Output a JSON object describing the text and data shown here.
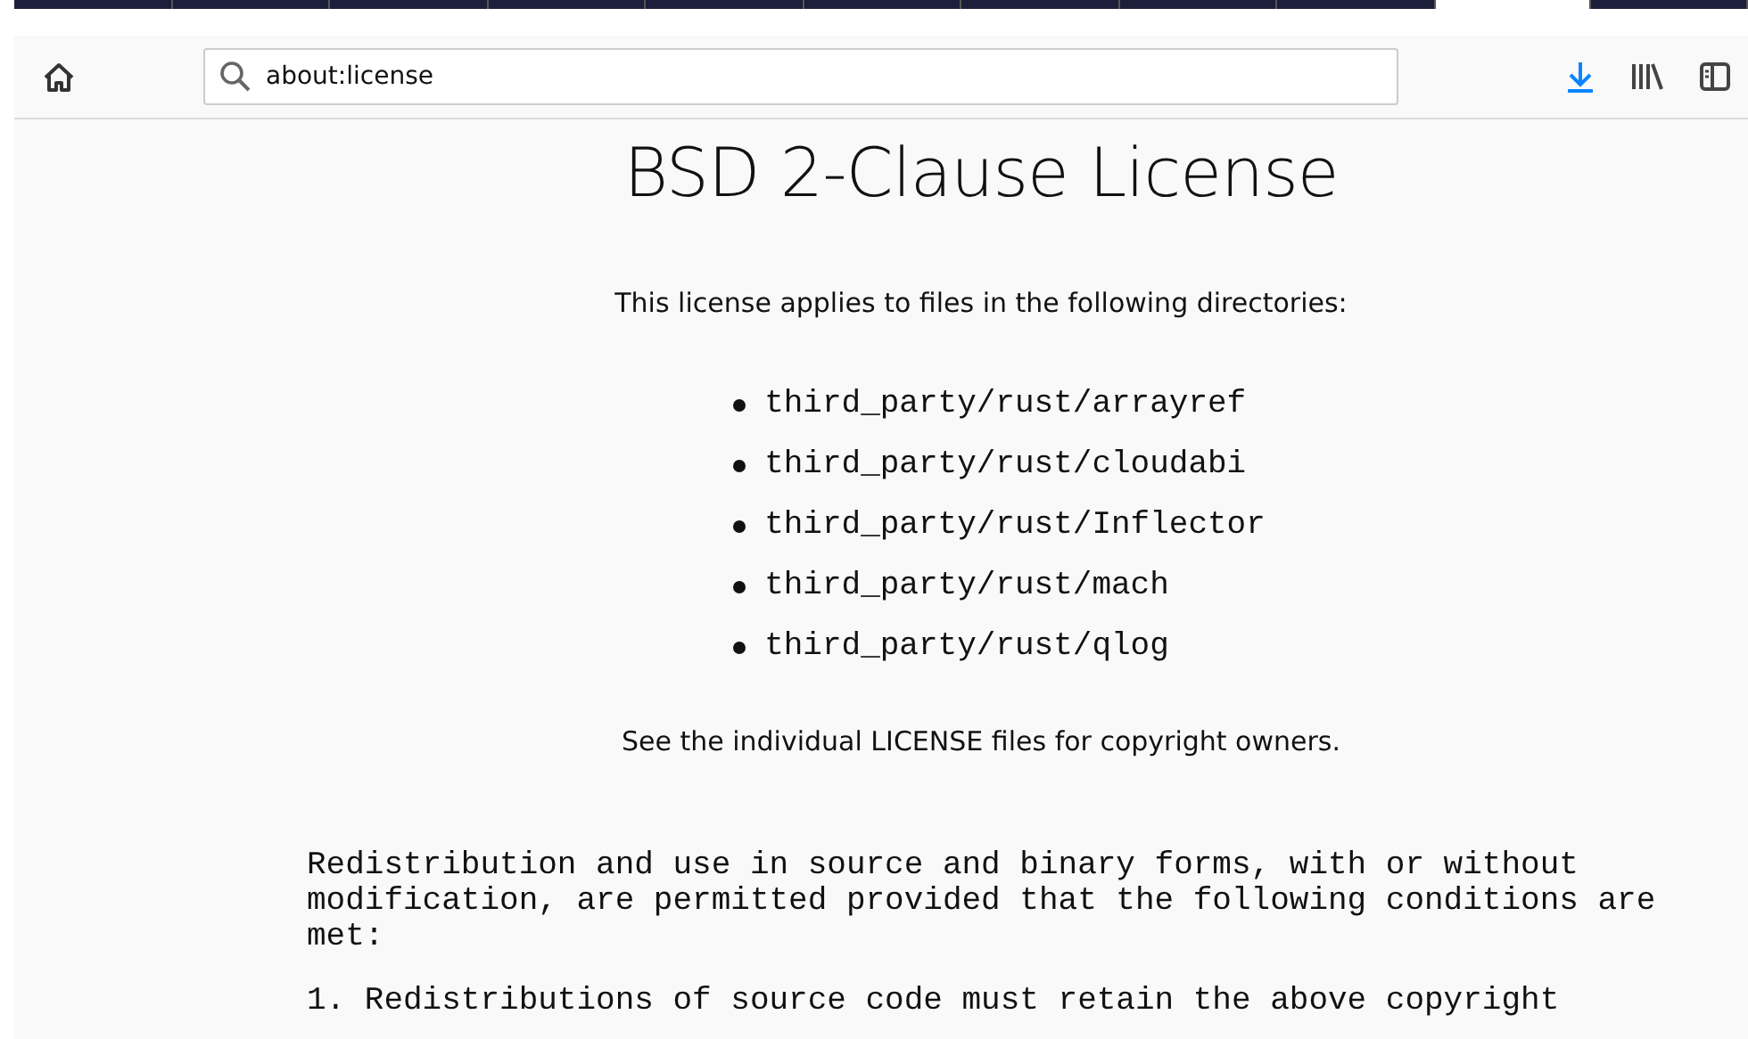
{
  "tabs": [
    {
      "selected": false
    },
    {
      "selected": false
    },
    {
      "selected": false
    },
    {
      "selected": false
    },
    {
      "selected": false
    },
    {
      "selected": false
    },
    {
      "selected": false
    },
    {
      "selected": false
    },
    {
      "selected": false
    },
    {
      "selected": true
    },
    {
      "selected": false
    }
  ],
  "address_bar": {
    "value": "about:license"
  },
  "page": {
    "title": "BSD 2-Clause License",
    "intro": "This license applies to files in the following directories:",
    "directories": [
      "third_party/rust/arrayref",
      "third_party/rust/cloudabi",
      "third_party/rust/Inflector",
      "third_party/rust/mach",
      "third_party/rust/qlog"
    ],
    "note": "See the individual LICENSE files for copyright owners.",
    "license_paragraphs": [
      [
        "Redistribution and use in source and binary forms, with or without",
        "modification, are permitted provided that the following conditions are",
        "met:"
      ],
      [
        "1. Redistributions of source code must retain the above copyright"
      ]
    ]
  }
}
